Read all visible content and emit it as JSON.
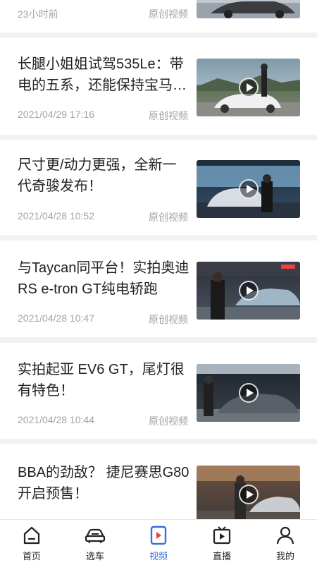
{
  "feed": {
    "items": [
      {
        "title": "",
        "date": "23小时前",
        "tag": "原创视频"
      },
      {
        "title": "长腿小姐姐试驾535Le：带电的五系，还能保持宝马…",
        "date": "2021/04/29 17:16",
        "tag": "原创视频"
      },
      {
        "title": "尺寸更/动力更强，全新一代奇骏发布！",
        "date": "2021/04/28 10:52",
        "tag": "原创视频"
      },
      {
        "title": "与Taycan同平台！实拍奥迪RS e-tron GT纯电轿跑",
        "date": "2021/04/28 10:47",
        "tag": "原创视频"
      },
      {
        "title": "实拍起亚 EV6 GT，尾灯很有特色！",
        "date": "2021/04/28 10:44",
        "tag": "原创视频"
      },
      {
        "title": "BBA的劲敌？ 捷尼赛思G80开启预售！",
        "date": "",
        "tag": ""
      }
    ]
  },
  "tabbar": {
    "tabs": [
      {
        "label": "首页",
        "icon": "home-icon"
      },
      {
        "label": "选车",
        "icon": "car-icon"
      },
      {
        "label": "视频",
        "icon": "video-icon"
      },
      {
        "label": "直播",
        "icon": "live-tv-icon"
      },
      {
        "label": "我的",
        "icon": "profile-icon"
      }
    ],
    "active_index": 2,
    "active_color": "#3a6fd8",
    "accent_red": "#e8433e"
  }
}
